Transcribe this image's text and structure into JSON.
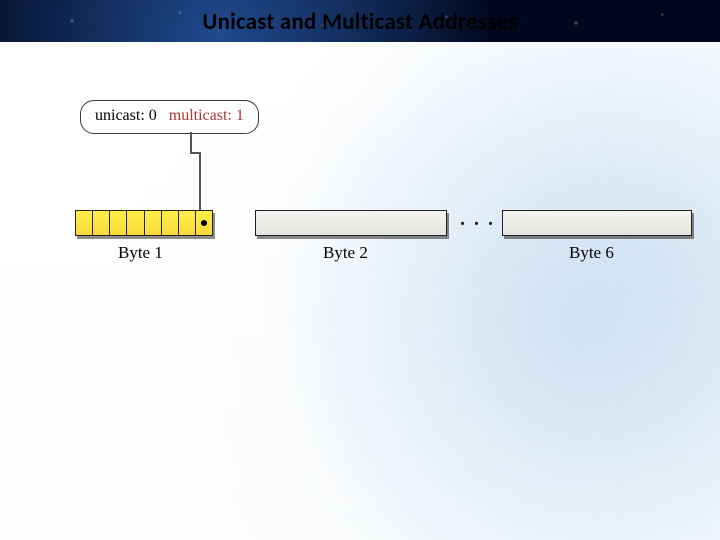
{
  "title": "Unicast and Multicast Addresses",
  "legend": {
    "unicast_label": "unicast: 0",
    "multicast_label": "multicast: 1"
  },
  "ellipsis": ". . .",
  "bytes": {
    "byte1_label": "Byte 1",
    "byte2_label": "Byte 2",
    "byte6_label": "Byte 6",
    "byte1_bit_count": 8,
    "byte1_highlight_color": "#f6d93a",
    "byte1_last_bit_marker": "dot"
  }
}
